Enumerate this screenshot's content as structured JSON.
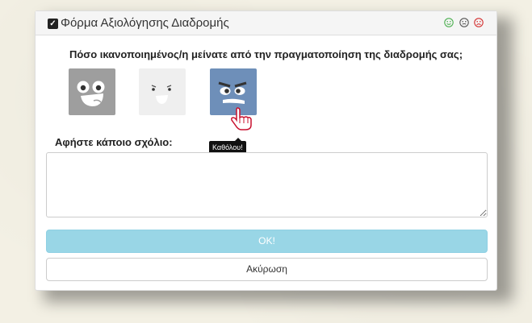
{
  "form": {
    "title": "Φόρμα Αξιολόγησης Διαδρομής",
    "question": "Πόσο ικανοποιημένος/η μείνατε από την πραγματοποίηση της διαδρομής σας;",
    "comment_label": "Αφήστε κάποιο σχόλιο:",
    "comment_value": "",
    "tooltip": "Καθόλου!",
    "ok_label": "OK!",
    "cancel_label": "Ακύρωση",
    "faces": [
      {
        "name": "happy",
        "color": "#9e9e9e"
      },
      {
        "name": "neutral",
        "color": "#efefef"
      },
      {
        "name": "angry",
        "color": "#6e8fb9"
      }
    ]
  },
  "colors": {
    "ok_button": "#99d6e6",
    "angry_face": "#6e8fb9",
    "cursor": "#c8102e"
  }
}
